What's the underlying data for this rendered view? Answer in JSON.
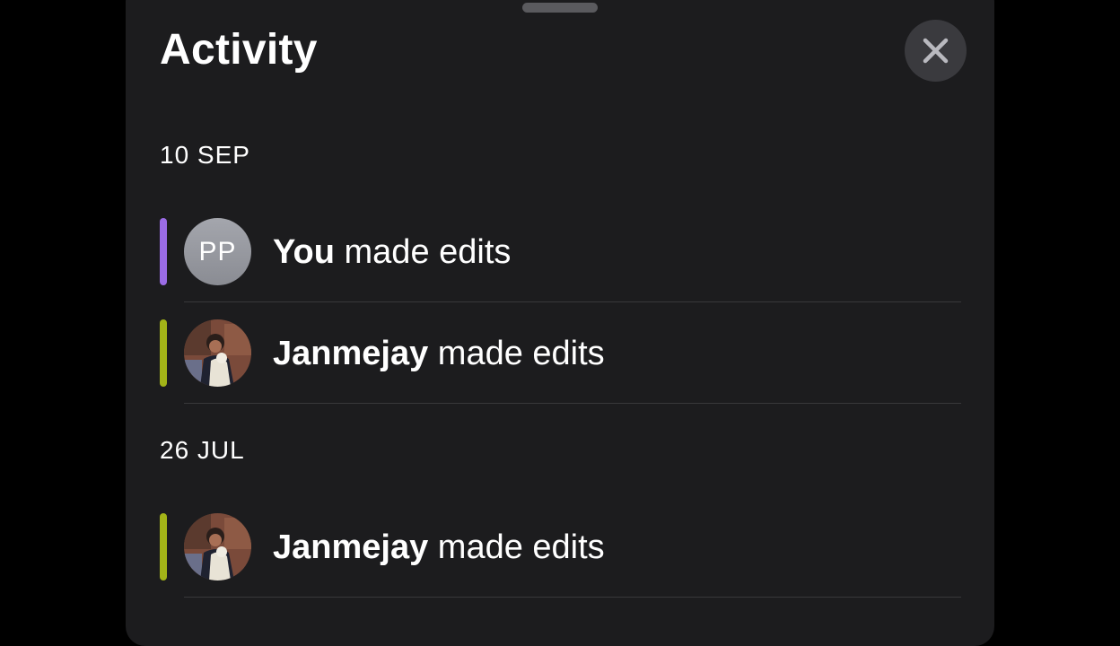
{
  "sheet": {
    "title": "Activity"
  },
  "icons": {
    "close": "close-icon",
    "grabber": "sheet-grabber"
  },
  "colors": {
    "background": "#000000",
    "sheet": "#1c1c1e",
    "you_marker": "#9b6ce6",
    "janmejay_marker": "#a3b418",
    "divider": "#38383a"
  },
  "sections": [
    {
      "date": "10 SEP",
      "items": [
        {
          "name": "You",
          "action": "made edits",
          "avatar_initials": "PP"
        },
        {
          "name": "Janmejay",
          "action": "made edits"
        }
      ]
    },
    {
      "date": "26 JUL",
      "items": [
        {
          "name": "Janmejay",
          "action": "made edits"
        }
      ]
    }
  ]
}
